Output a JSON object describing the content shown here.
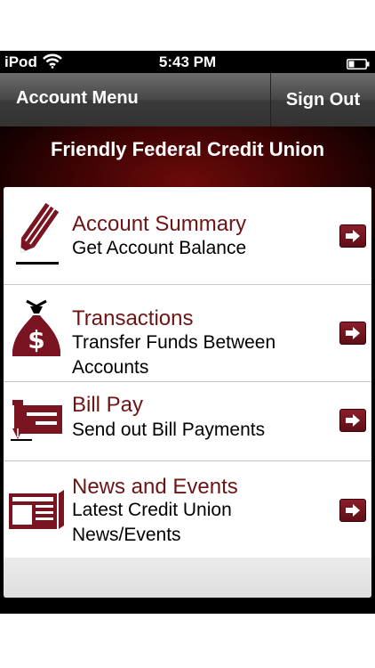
{
  "status_bar": {
    "carrier": "iPod",
    "time": "5:43 PM"
  },
  "navbar": {
    "title": "Account Menu",
    "sign_out_label": "Sign Out"
  },
  "header": {
    "title": "Friendly Federal Credit Union"
  },
  "menu": {
    "items": [
      {
        "title": "Account Summary",
        "subtitle": "Get Account Balance",
        "icon": "pencil-icon"
      },
      {
        "title": "Transactions",
        "subtitle": "Transfer Funds Between Accounts",
        "icon": "money-bag-icon"
      },
      {
        "title": "Bill Pay",
        "subtitle": "Send out Bill Payments",
        "icon": "check-pen-icon"
      },
      {
        "title": "News and Events",
        "subtitle": "Latest Credit Union News/Events",
        "icon": "newspaper-icon"
      }
    ]
  },
  "colors": {
    "brand": "#7a1420",
    "title_text": "#6f1414",
    "navbar": "#4a4a4a"
  }
}
